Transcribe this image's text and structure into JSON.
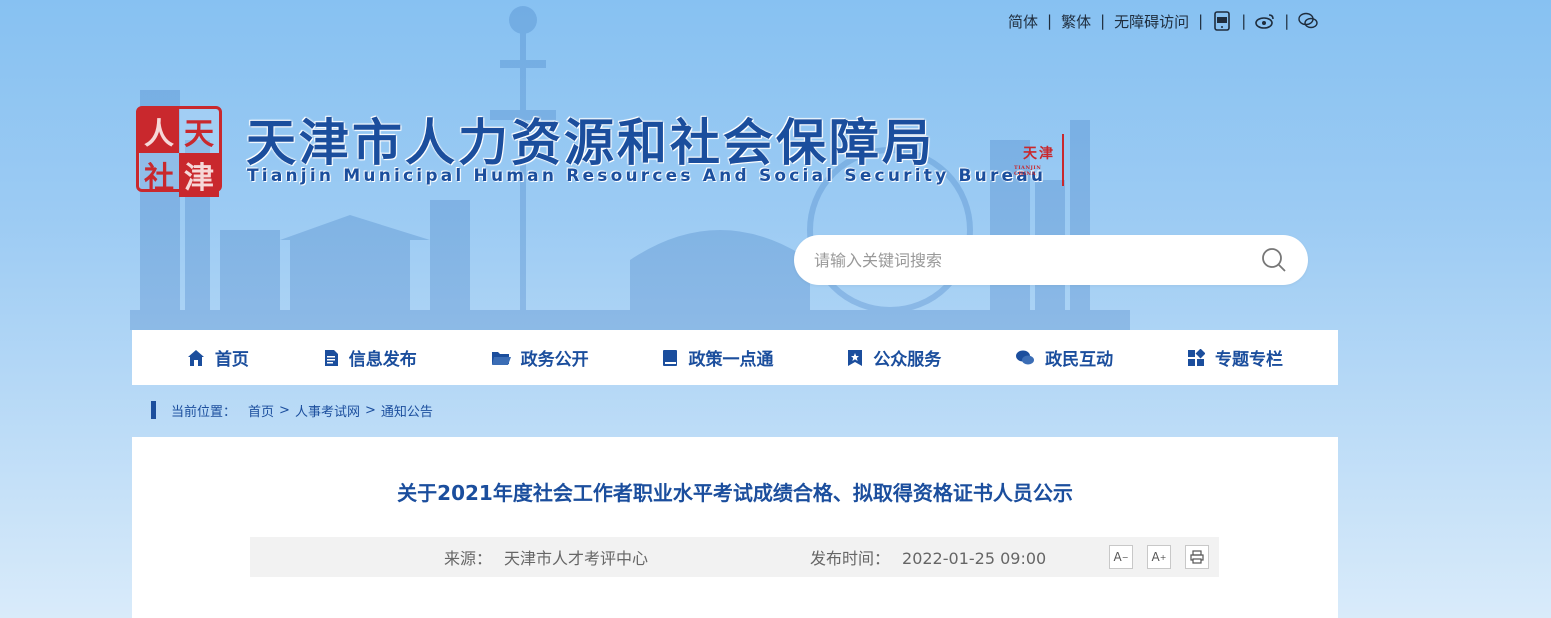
{
  "topbar": {
    "simplified": "简体",
    "traditional": "繁体",
    "accessible": "无障碍访问",
    "separator": "|"
  },
  "header": {
    "title": "天津市人力资源和社会保障局",
    "subtitle": "Tianjin Municipal Human Resources And Social Security Bureau",
    "seal_chars": [
      "人",
      "天",
      "社",
      "津"
    ],
    "mini_seal_chars": [
      "天",
      "津"
    ],
    "mini_seal_caption": "TIANJIN CHINA"
  },
  "search": {
    "placeholder": "请输入关键词搜索"
  },
  "nav": {
    "items": [
      {
        "label": "首页",
        "icon": "home-icon"
      },
      {
        "label": "信息发布",
        "icon": "document-icon"
      },
      {
        "label": "政务公开",
        "icon": "folder-icon"
      },
      {
        "label": "政策一点通",
        "icon": "book-icon"
      },
      {
        "label": "公众服务",
        "icon": "bookmark-star-icon"
      },
      {
        "label": "政民互动",
        "icon": "chat-icon"
      },
      {
        "label": "专题专栏",
        "icon": "grid-icon"
      }
    ]
  },
  "breadcrumb": {
    "prefix": "当前位置：",
    "items": [
      "首页",
      "人事考试网",
      "通知公告"
    ],
    "separator": ">"
  },
  "article": {
    "title": "关于2021年度社会工作者职业水平考试成绩合格、拟取得资格证书人员公示",
    "source_label": "来源：",
    "source": "天津市人才考评中心",
    "time_label": "发布时间：",
    "time": "2022-01-25 09:00",
    "tools": {
      "font_smaller": "A",
      "font_larger": "A",
      "minus": "−",
      "plus": "+"
    }
  },
  "colors": {
    "brand_blue": "#1b4e9d",
    "seal_red": "#c9282d",
    "bg_top": "#87c1f2",
    "meta_bg": "#f2f2f2"
  }
}
